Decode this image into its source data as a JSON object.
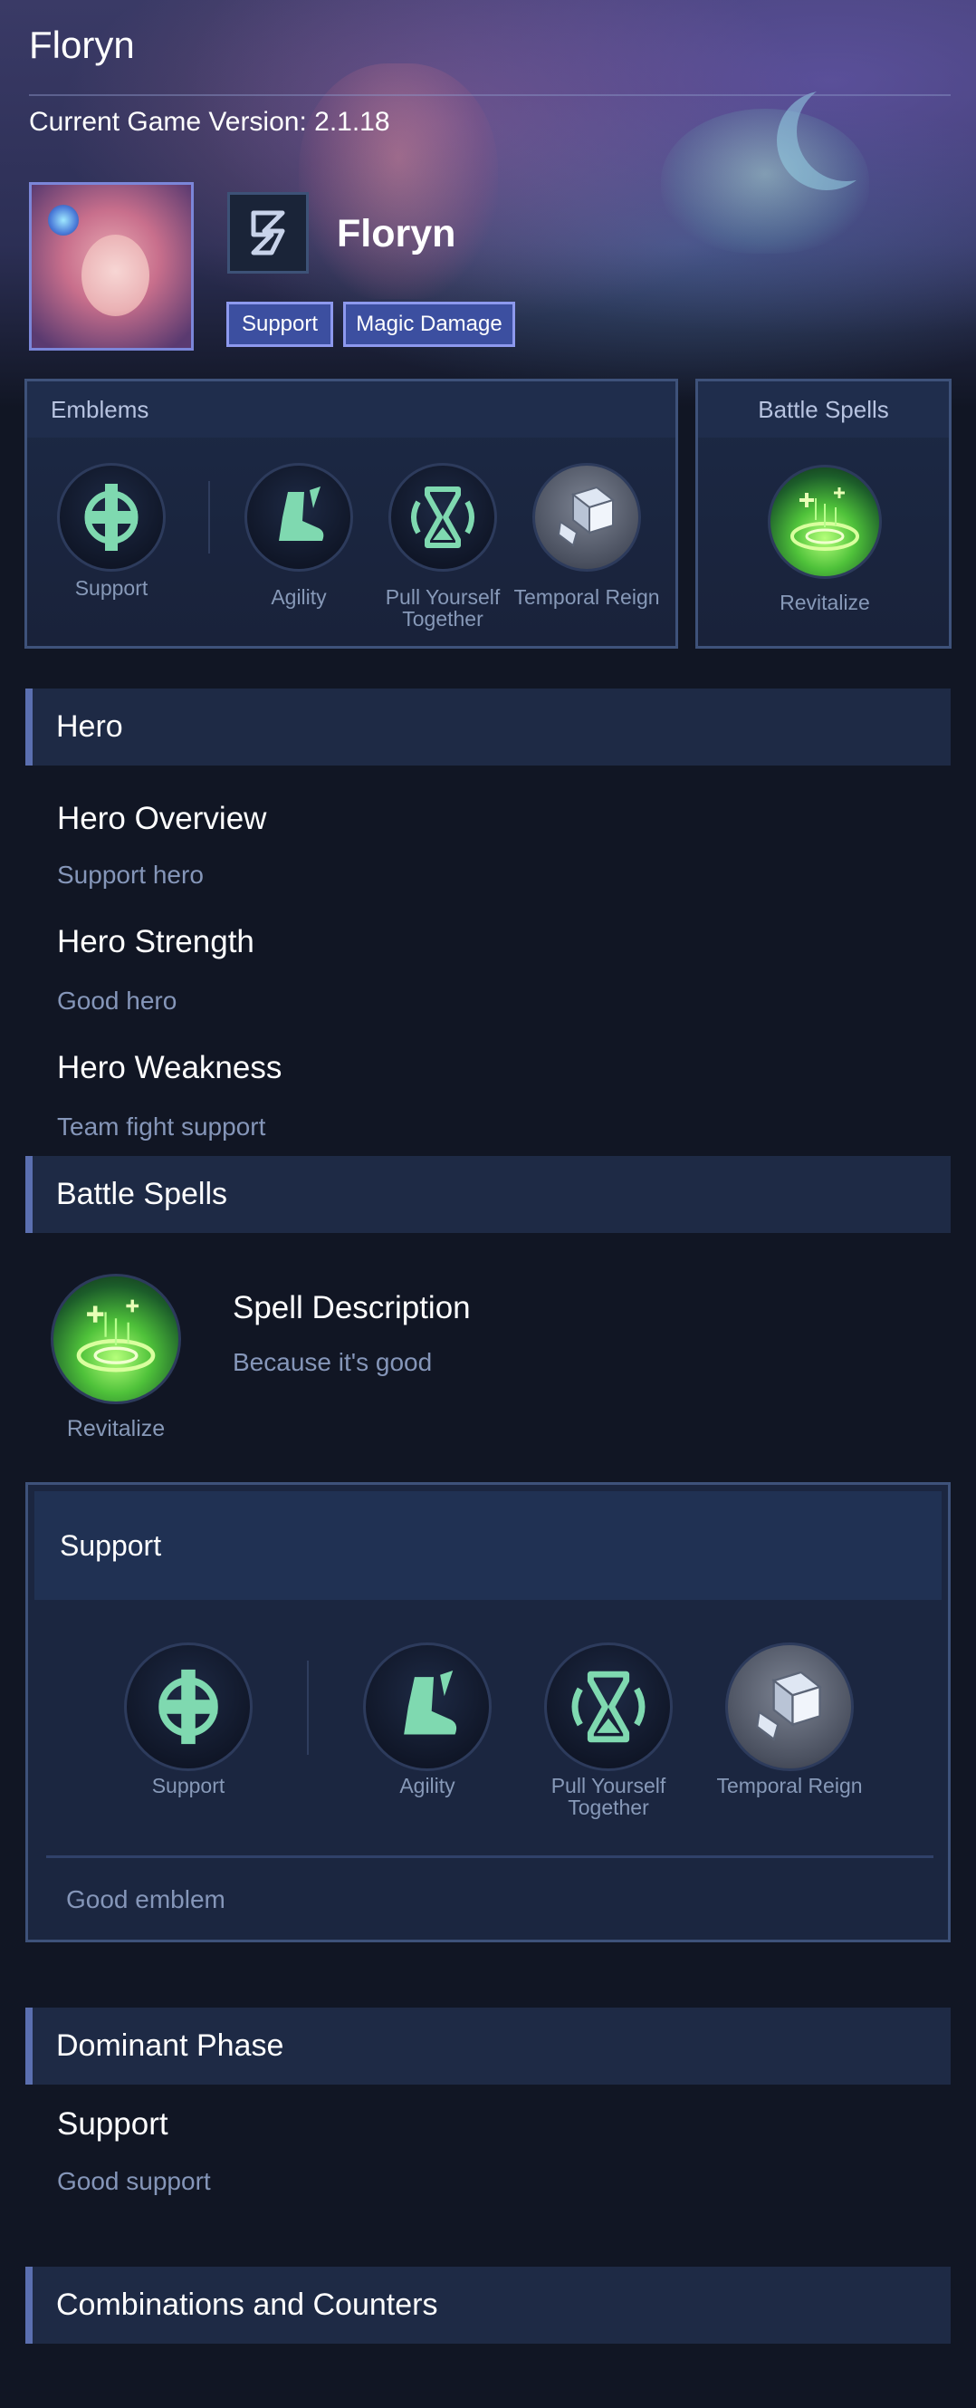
{
  "page": {
    "title": "Floryn",
    "version_text": "Current Game Version: 2.1.18"
  },
  "hero": {
    "name": "Floryn",
    "tags": [
      "Support",
      "Magic Damage"
    ],
    "portrait_icon": "hero-portrait",
    "role_icon": "support-role-icon"
  },
  "emblems_panel": {
    "title": "Emblems",
    "items": [
      {
        "label": "Support",
        "icon": "support-cross-icon"
      },
      {
        "label": "Agility",
        "icon": "boot-icon"
      },
      {
        "label": "Pull Yourself Together",
        "icon": "hourglass-icon"
      },
      {
        "label": "Temporal Reign",
        "icon": "cube-icon"
      }
    ]
  },
  "battle_spells_panel": {
    "title": "Battle Spells",
    "spell": {
      "label": "Revitalize",
      "icon": "revitalize-icon"
    }
  },
  "sections": {
    "hero": {
      "title": "Hero",
      "overview_title": "Hero Overview",
      "overview_text": "Support hero",
      "strength_title": "Hero Strength",
      "strength_text": "Good hero",
      "weakness_title": "Hero Weakness",
      "weakness_text": "Team fight support"
    },
    "battle_spells": {
      "title": "Battle Spells",
      "spell_label": "Revitalize",
      "desc_title": "Spell Description",
      "desc_text": "Because it's good"
    },
    "support_emblem": {
      "title": "Support",
      "items": [
        {
          "label": "Support",
          "icon": "support-cross-icon"
        },
        {
          "label": "Agility",
          "icon": "boot-icon"
        },
        {
          "label": "Pull Yourself Together",
          "icon": "hourglass-icon"
        },
        {
          "label": "Temporal Reign",
          "icon": "cube-icon"
        }
      ],
      "note": "Good emblem"
    },
    "dominant_phase": {
      "title": "Dominant Phase",
      "sub_title": "Support",
      "sub_text": "Good support"
    },
    "combinations": {
      "title": "Combinations and Counters"
    }
  },
  "colors": {
    "background": "#111624",
    "panel": "#1c2945",
    "accent_border": "#5b6fb0",
    "tag_bg": "#3c4fa0",
    "muted_text": "#8596b9",
    "emblem_green": "#7fd9b0"
  }
}
